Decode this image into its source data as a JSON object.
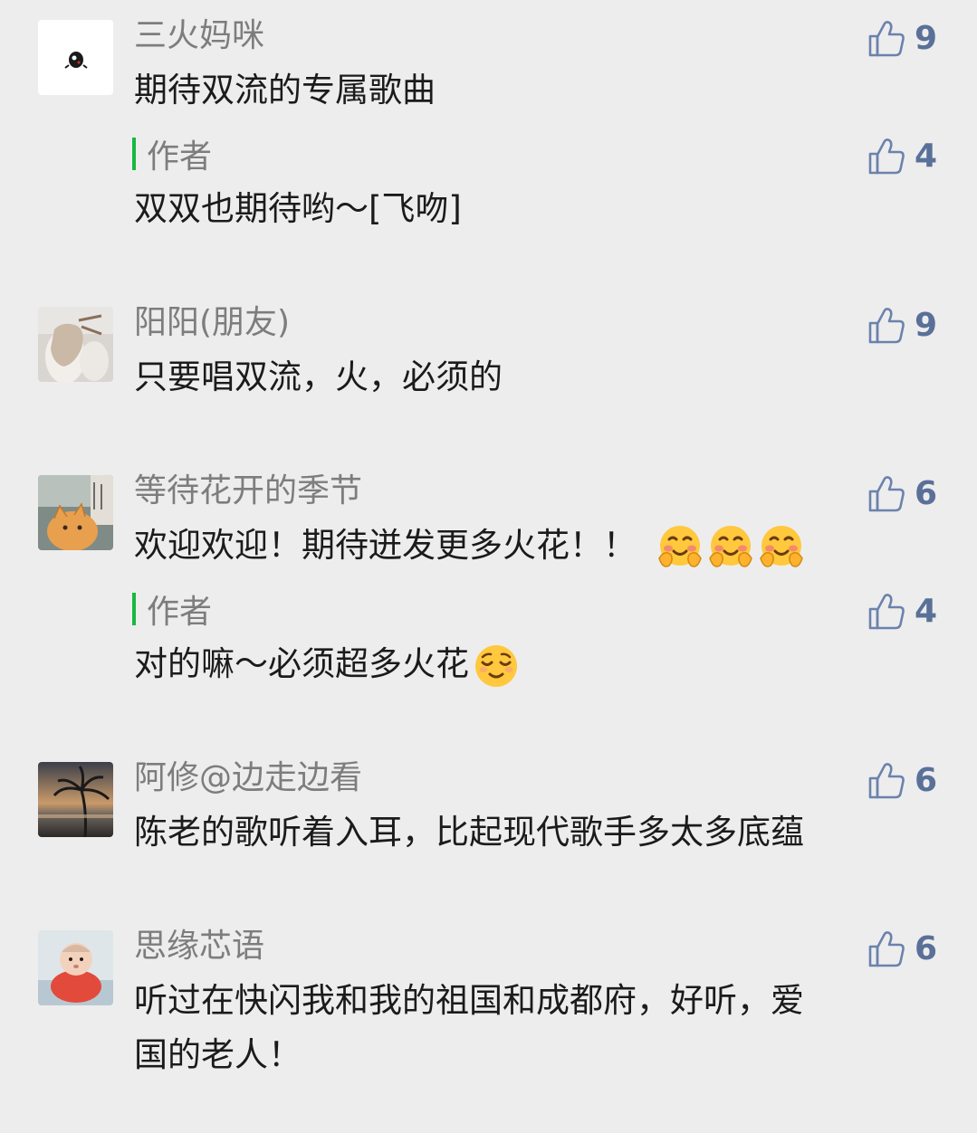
{
  "comments": [
    {
      "user": "三火妈咪",
      "text": "期待双流的专属歌曲",
      "likes": "9",
      "reply": {
        "label": "作者",
        "text": "双双也期待哟～[飞吻]",
        "likes": "4"
      }
    },
    {
      "user": "阳阳(朋友)",
      "text": "只要唱双流，火，必须的",
      "likes": "9"
    },
    {
      "user": "等待花开的季节",
      "text": "欢迎欢迎！期待迸发更多火花！！",
      "emoji": "hugging-face-emoji",
      "likes": "6",
      "reply": {
        "label": "作者",
        "text": "对的嘛～必须超多火花",
        "emoji": "relieved-face-emoji",
        "likes": "4"
      }
    },
    {
      "user": "阿修@边走边看",
      "text": "陈老的歌听着入耳，比起现代歌手多太多底蕴",
      "likes": "6"
    },
    {
      "user": "思缘芯语",
      "text_line1": "听过在快闪我和我的祖国和成都府，好听，爱",
      "text_line2": "国的老人！",
      "likes": "6"
    }
  ],
  "colors": {
    "background": "#ededed",
    "name": "#7d7d7d",
    "text": "#1b1b1b",
    "like": "#5a7099",
    "reply_bar": "#19b93f"
  },
  "icons": {
    "like": "thumbs-up-icon"
  }
}
